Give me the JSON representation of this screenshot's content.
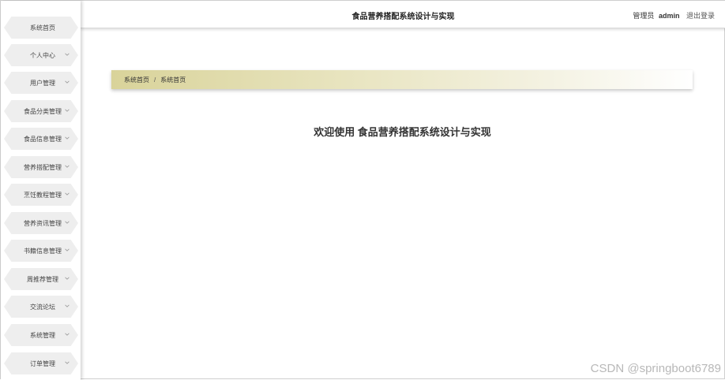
{
  "app": {
    "title": "食品营养搭配系统设计与实现"
  },
  "header": {
    "role": "管理员",
    "username": "admin",
    "logout_label": "退出登录"
  },
  "sidebar": {
    "items": [
      {
        "label": "系统首页",
        "has_submenu": false
      },
      {
        "label": "个人中心",
        "has_submenu": true
      },
      {
        "label": "用户管理",
        "has_submenu": true
      },
      {
        "label": "食品分类管理",
        "has_submenu": true
      },
      {
        "label": "食品信息管理",
        "has_submenu": true
      },
      {
        "label": "营养搭配管理",
        "has_submenu": true
      },
      {
        "label": "烹饪教程管理",
        "has_submenu": true
      },
      {
        "label": "营养资讯管理",
        "has_submenu": true
      },
      {
        "label": "书籍信息管理",
        "has_submenu": true
      },
      {
        "label": "周推荐管理",
        "has_submenu": true
      },
      {
        "label": "交流论坛",
        "has_submenu": true
      },
      {
        "label": "系统管理",
        "has_submenu": true
      },
      {
        "label": "订单管理",
        "has_submenu": true
      }
    ]
  },
  "breadcrumb": {
    "items": [
      "系统首页",
      "系统首页"
    ],
    "separator": "/"
  },
  "main": {
    "welcome_text": "欢迎使用 食品营养搭配系统设计与实现"
  },
  "watermark": {
    "text": "CSDN @springboot6789"
  },
  "colors": {
    "menu_bg": "#eeeeee",
    "breadcrumb_gradient_start": "#d9d39a",
    "breadcrumb_gradient_end": "#ffffff"
  }
}
